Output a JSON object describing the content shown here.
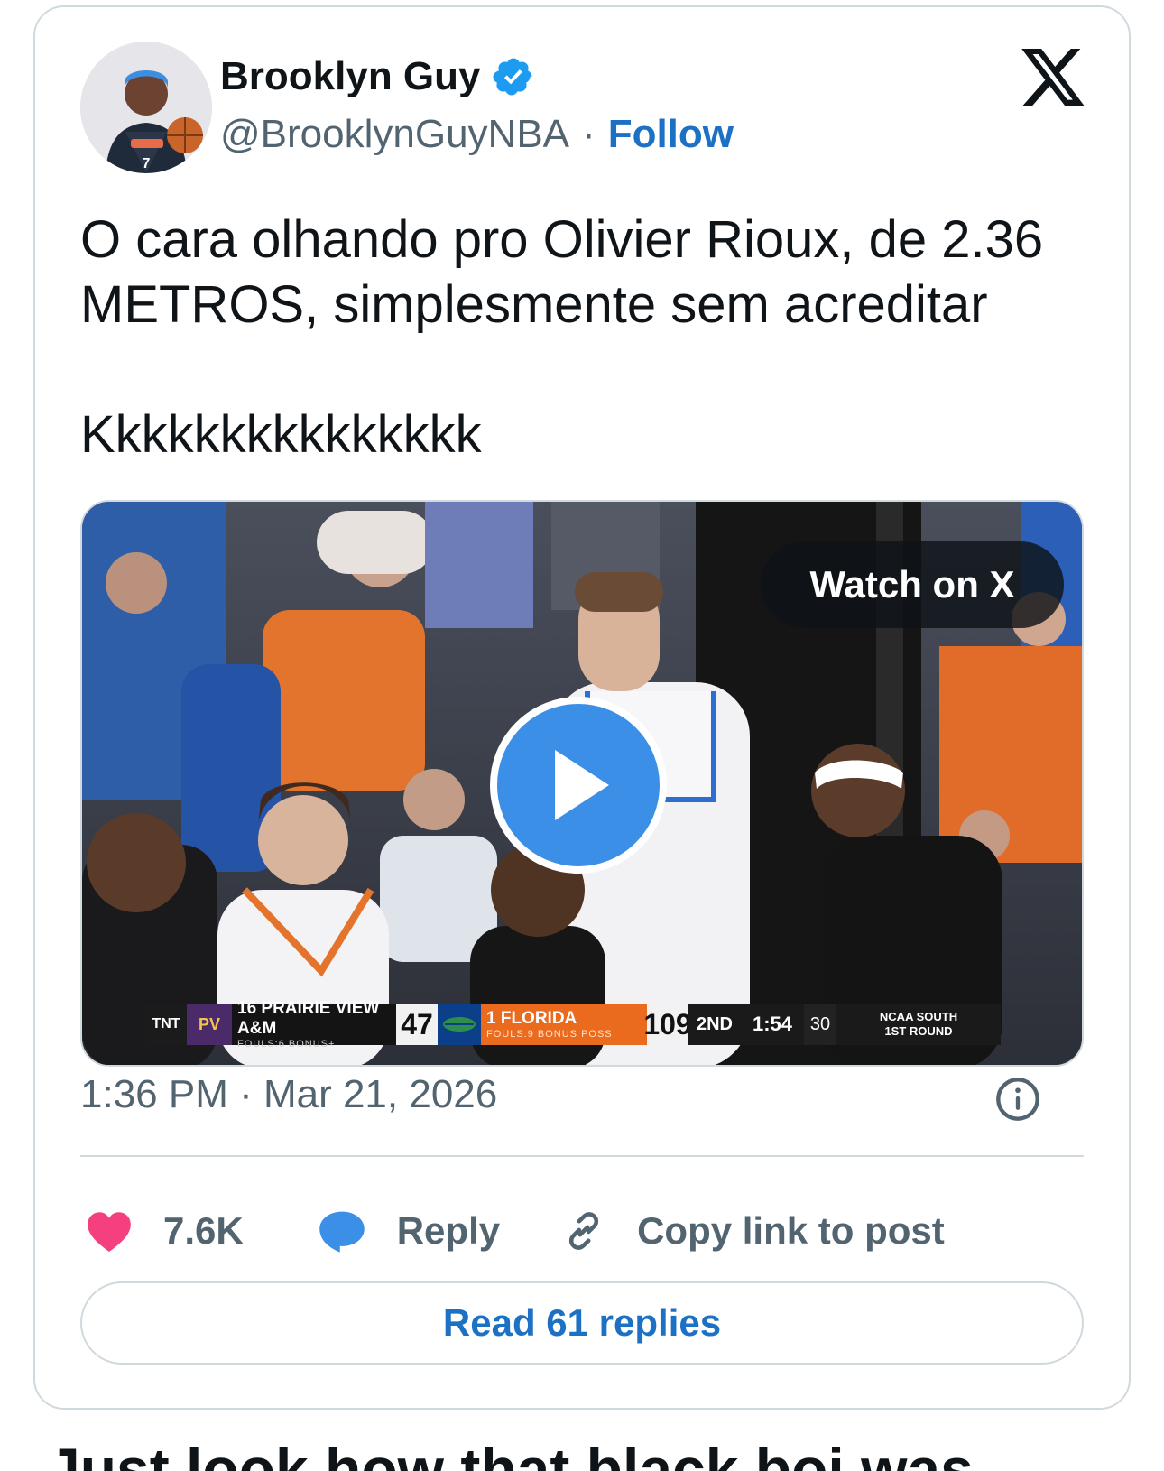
{
  "author": {
    "display_name": "Brooklyn Guy",
    "handle": "@BrooklynGuyNBA",
    "separator": "·",
    "follow_label": "Follow"
  },
  "tweet": {
    "text": "O cara olhando pro Olivier Rioux, de 2.36\nMETROS, simplesmente sem acreditar\n\nKkkkkkkkkkkkkkk"
  },
  "media": {
    "watch_label": "Watch on X",
    "scorebug": {
      "network": "TNT",
      "team1_logo": "PV",
      "team1_name": "16 PRAIRIE VIEW A&M",
      "team1_sub": "FOULS:6   BONUS+",
      "team1_score": "47",
      "team2_name": "1  FLORIDA",
      "team2_sub": "FOULS:9     BONUS      POSS",
      "team2_score": "109",
      "period": "2ND",
      "clock": "1:54",
      "shot_clock": "30",
      "round_line1": "NCAA SOUTH",
      "round_line2": "1ST ROUND"
    }
  },
  "timestamp": "1:36 PM · Mar 21, 2026",
  "actions": {
    "likes": "7.6K",
    "reply_label": "Reply",
    "copy_label": "Copy link to post"
  },
  "read_replies_label": "Read 61 replies",
  "below_text": "Just look how that black boi was",
  "colors": {
    "link_blue": "#1d71c4",
    "like_pink": "#f4407f",
    "reply_blue": "#3b8fe6",
    "verified_blue": "#1d9bf0"
  }
}
